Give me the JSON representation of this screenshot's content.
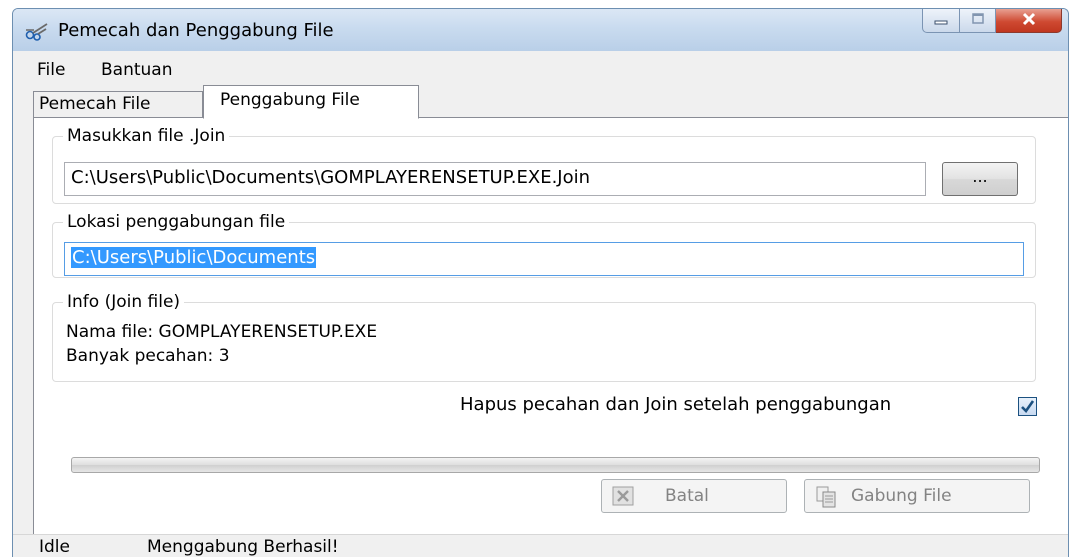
{
  "window": {
    "title": "Pemecah dan Penggabung File",
    "icon": "scissors-icon",
    "controls": {
      "minimize": "minimize-icon",
      "maximize": "maximize-icon",
      "close": "close-icon"
    }
  },
  "menu": {
    "items": [
      "File",
      "Bantuan"
    ]
  },
  "tabs": [
    {
      "label": "Pemecah File",
      "active": false
    },
    {
      "label": "Penggabung File",
      "active": true
    }
  ],
  "join_file_group": {
    "legend": "Masukkan file .Join",
    "path_value": "C:\\Users\\Public\\Documents\\GOMPLAYERENSETUP.EXE.Join",
    "browse_label": "..."
  },
  "location_group": {
    "legend": "Lokasi penggabungan file",
    "path_value": "C:\\Users\\Public\\Documents"
  },
  "info_group": {
    "legend": "Info (Join file)",
    "lines": [
      "Nama file: GOMPLAYERENSETUP.EXE",
      "Banyak pecahan: 3"
    ]
  },
  "delete_option": {
    "label": "Hapus pecahan dan Join setelah penggabungan",
    "checked": true
  },
  "progress": {
    "fraction": 0
  },
  "buttons": {
    "cancel": {
      "label": "Batal",
      "icon": "cancel-icon",
      "enabled": false
    },
    "join": {
      "label": "Gabung File",
      "icon": "join-files-icon",
      "enabled": false
    }
  },
  "status": {
    "state": "Idle",
    "message": "Menggabung Berhasil!"
  },
  "colors": {
    "selection": "#3399ff",
    "checkmark": "#1c5180",
    "close_button": "#c0361f"
  }
}
